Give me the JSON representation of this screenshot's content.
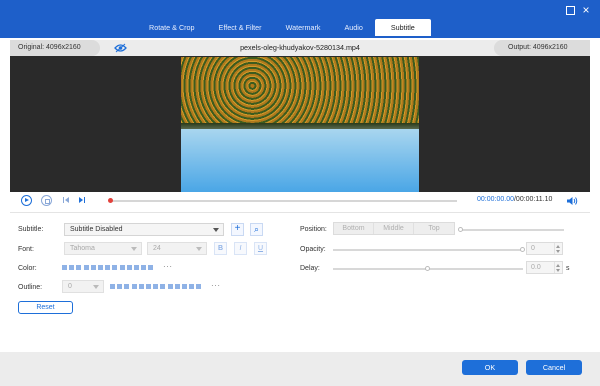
{
  "tabs": [
    {
      "label": "Rotate & Crop"
    },
    {
      "label": "Effect & Filter"
    },
    {
      "label": "Watermark"
    },
    {
      "label": "Audio"
    },
    {
      "label": "Subtitle",
      "active": true
    }
  ],
  "window": {
    "minimize_icon": "square-icon",
    "close_icon": "close-icon",
    "close_glyph": "×"
  },
  "info_bar": {
    "original": "Original: 4096x2160",
    "filename": "pexels-oleg-khudyakov-5280134.mp4",
    "output": "Output: 4096x2160",
    "eye_icon": "eye-icon"
  },
  "playback": {
    "current_time": "00:00:00.00",
    "total_time": "/00:00:11.10",
    "progress": 0,
    "accent": "#1e6fd9",
    "knob_color": "#e2413b"
  },
  "subtitle": {
    "label": "Subtitle:",
    "value": "Subtitle Disabled",
    "add_glyph": "+",
    "search_glyph": "⌕"
  },
  "font": {
    "label": "Font:",
    "family": "Tahoma",
    "size": "24",
    "bold": "B",
    "italic": "I",
    "underline": "U"
  },
  "color": {
    "label": "Color:",
    "more": "···"
  },
  "outline": {
    "label": "Outline:",
    "value": "0",
    "more": "···"
  },
  "reset_label": "Reset",
  "position": {
    "label": "Position:",
    "options": [
      "Bottom",
      "Middle",
      "Top"
    ]
  },
  "opacity": {
    "label": "Opacity:",
    "value": "0",
    "level": 1.0
  },
  "delay": {
    "label": "Delay:",
    "value": "0.0",
    "unit": "s",
    "level": 0.5
  },
  "footer": {
    "ok": "OK",
    "cancel": "Cancel"
  },
  "colors": {
    "titlebar": "#1e5fc9",
    "accent": "#1e6fd9",
    "swatch": "#8fb2e6"
  }
}
